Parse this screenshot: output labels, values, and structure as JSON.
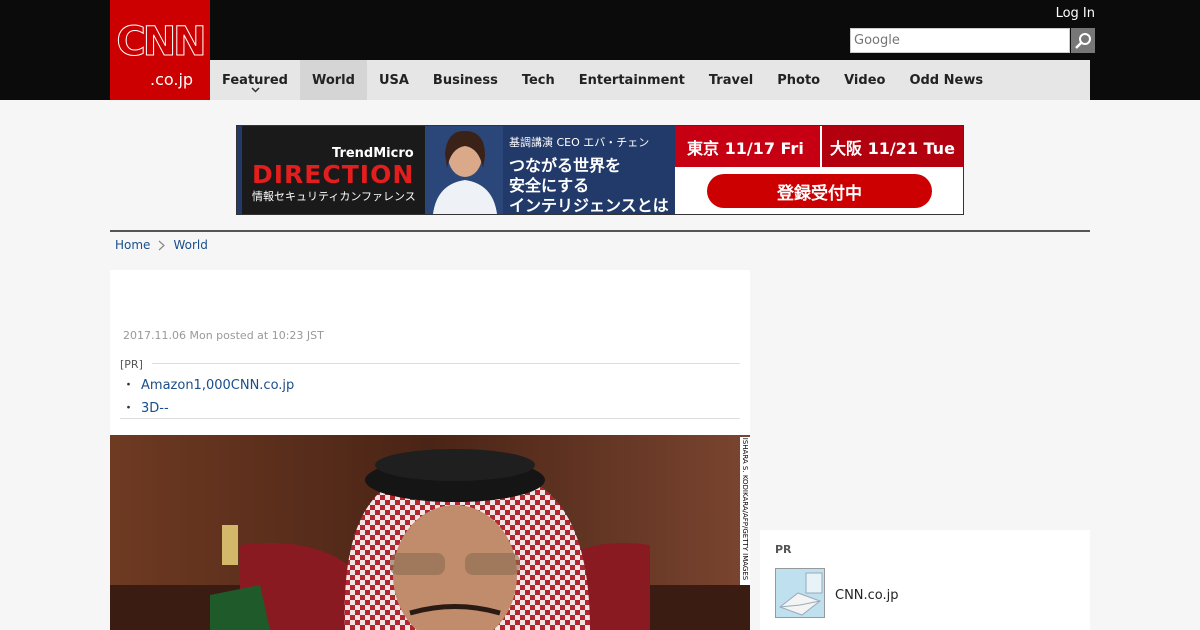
{
  "header": {
    "logo_text": "CNN",
    "logo_domain": ".co.jp",
    "login_label": "Log In",
    "search": {
      "placeholder": "Google"
    }
  },
  "nav": {
    "items": [
      {
        "label": "Featured",
        "active": true
      },
      {
        "label": "World",
        "active": true
      },
      {
        "label": "USA"
      },
      {
        "label": "Business"
      },
      {
        "label": "Tech"
      },
      {
        "label": "Entertainment"
      },
      {
        "label": "Travel"
      },
      {
        "label": "Photo"
      },
      {
        "label": "Video"
      },
      {
        "label": "Odd News"
      }
    ]
  },
  "banner": {
    "brand": "TrendMicro",
    "title": "DIRECTION",
    "conference": "情報セキュリティカンファレンス",
    "speaker": "基調講演 CEO エバ・チェン",
    "lines": [
      "つながる世界を",
      "安全にする",
      "インテリジェンスとは"
    ],
    "date_tokyo": "東京 11/17 Fri",
    "date_osaka": "大阪 11/21 Tue",
    "register": "登録受付中"
  },
  "breadcrumb": {
    "home": "Home",
    "section": "World"
  },
  "article": {
    "posted": "2017.11.06 Mon posted at 10:23 JST",
    "pr_label": "[PR]",
    "pr_links": [
      "Amazon1,000CNN.co.jp",
      "3D--"
    ],
    "photo_credit": "ISHARA S. KODIKARA/AFP/GETTY IMAGES"
  },
  "sidebar": {
    "pr_label": "PR",
    "item_label": "CNN.co.jp"
  },
  "colors": {
    "brand_red": "#cc0000",
    "header_bg": "#0b0b0b",
    "nav_bg": "#e6e6e6",
    "link": "#1a4e8a"
  }
}
